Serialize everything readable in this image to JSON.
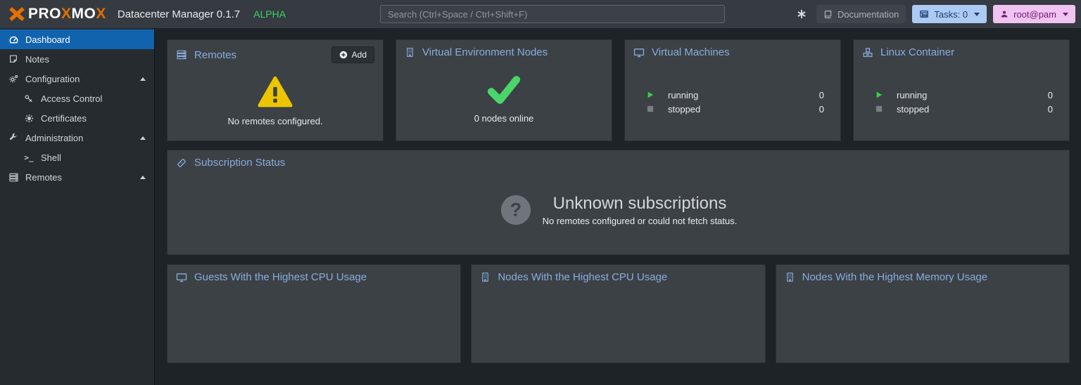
{
  "header": {
    "logo": {
      "p1": "PRO",
      "x1": "X",
      "p2": "MO",
      "x2": "X"
    },
    "title": "Datacenter Manager 0.1.7",
    "badge": "ALPHA",
    "search_placeholder": "Search (Ctrl+Space / Ctrl+Shift+F)",
    "documentation_label": "Documentation",
    "tasks_label": "Tasks: 0",
    "user_label": "root@pam"
  },
  "sidebar": {
    "items": [
      {
        "label": "Dashboard",
        "selected": true
      },
      {
        "label": "Notes"
      },
      {
        "label": "Configuration"
      },
      {
        "label": "Access Control"
      },
      {
        "label": "Certificates"
      },
      {
        "label": "Administration"
      },
      {
        "label": "Shell"
      },
      {
        "label": "Remotes"
      }
    ]
  },
  "panels": {
    "remotes": {
      "title": "Remotes",
      "add_label": "Add",
      "message": "No remotes configured."
    },
    "nodes": {
      "title": "Virtual Environment Nodes",
      "message": "0 nodes online"
    },
    "vms": {
      "title": "Virtual Machines",
      "rows": [
        {
          "label": "running",
          "value": "0"
        },
        {
          "label": "stopped",
          "value": "0"
        }
      ]
    },
    "lxc": {
      "title": "Linux Container",
      "rows": [
        {
          "label": "running",
          "value": "0"
        },
        {
          "label": "stopped",
          "value": "0"
        }
      ]
    },
    "subscription": {
      "title": "Subscription Status",
      "headline": "Unknown subscriptions",
      "subtext": "No remotes configured or could not fetch status."
    },
    "guests_cpu": {
      "title": "Guests With the Highest CPU Usage"
    },
    "nodes_cpu": {
      "title": "Nodes With the Highest CPU Usage"
    },
    "nodes_mem": {
      "title": "Nodes With the Highest Memory Usage"
    }
  },
  "colors": {
    "brand_orange": "#e57000",
    "alpha_green": "#3ed160",
    "selected_blue": "#1263ae",
    "panel_title_blue": "#8aabde",
    "tasks_btn_bg": "#accaf2",
    "tasks_btn_text": "#1d3e74",
    "user_btn_bg": "#f1c3f0",
    "user_btn_text": "#6d2077",
    "warning_yellow": "#ecc500",
    "success_green": "#49d56a",
    "running_green": "#35d04a",
    "stopped_gray": "#797e83",
    "header_bg": "#353b41",
    "sidebar_bg": "#262b2f",
    "panel_bg": "#3c4145",
    "content_bg": "#1e2327"
  }
}
